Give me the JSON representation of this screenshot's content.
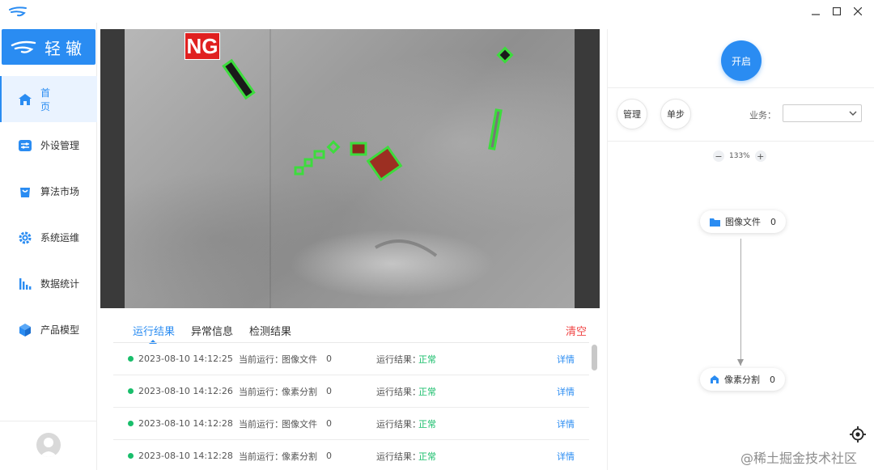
{
  "window": {
    "controls": [
      "minimize",
      "maximize",
      "close"
    ]
  },
  "brand": {
    "name": "轻辙"
  },
  "sidebar": {
    "items": [
      {
        "label": "首 页",
        "icon": "home-icon",
        "active": true
      },
      {
        "label": "外设管理",
        "icon": "peripheral-icon",
        "active": false
      },
      {
        "label": "算法市场",
        "icon": "market-icon",
        "active": false
      },
      {
        "label": "系统运维",
        "icon": "gear-icon",
        "active": false
      },
      {
        "label": "数据统计",
        "icon": "bar-chart-icon",
        "active": false
      },
      {
        "label": "产品模型",
        "icon": "cube-icon",
        "active": false
      }
    ]
  },
  "viewer": {
    "badge": "NG"
  },
  "results": {
    "tabs": [
      "运行结果",
      "异常信息",
      "检测结果"
    ],
    "active_tab": 0,
    "clear_label": "清空",
    "rows": [
      {
        "time": "2023-08-10 14:12:25",
        "current_label": "当前运行：",
        "current_value": "图像文件",
        "count": "0",
        "result_label": "运行结果：",
        "result_value": "正常",
        "detail": "详情"
      },
      {
        "time": "2023-08-10 14:12:26",
        "current_label": "当前运行：",
        "current_value": "像素分割",
        "count": "0",
        "result_label": "运行结果：",
        "result_value": "正常",
        "detail": "详情"
      },
      {
        "time": "2023-08-10 14:12:28",
        "current_label": "当前运行：",
        "current_value": "图像文件",
        "count": "0",
        "result_label": "运行结果：",
        "result_value": "正常",
        "detail": "详情"
      },
      {
        "time": "2023-08-10 14:12:28",
        "current_label": "当前运行：",
        "current_value": "像素分割",
        "count": "0",
        "result_label": "运行结果：",
        "result_value": "正常",
        "detail": "详情"
      }
    ]
  },
  "panel": {
    "start_label": "开启",
    "manage_label": "管理",
    "step_label": "单步",
    "business_label": "业务：",
    "business_value": "",
    "zoom": "133%",
    "nodes": [
      {
        "label": "图像文件",
        "count": "0",
        "icon": "folder-icon"
      },
      {
        "label": "像素分割",
        "count": "0",
        "icon": "segment-icon"
      }
    ]
  },
  "watermark": "@稀土掘金技术社区",
  "colors": {
    "accent": "#2a8cf2",
    "ok": "#19be6b",
    "danger": "#f04545",
    "ng": "#e02020"
  }
}
